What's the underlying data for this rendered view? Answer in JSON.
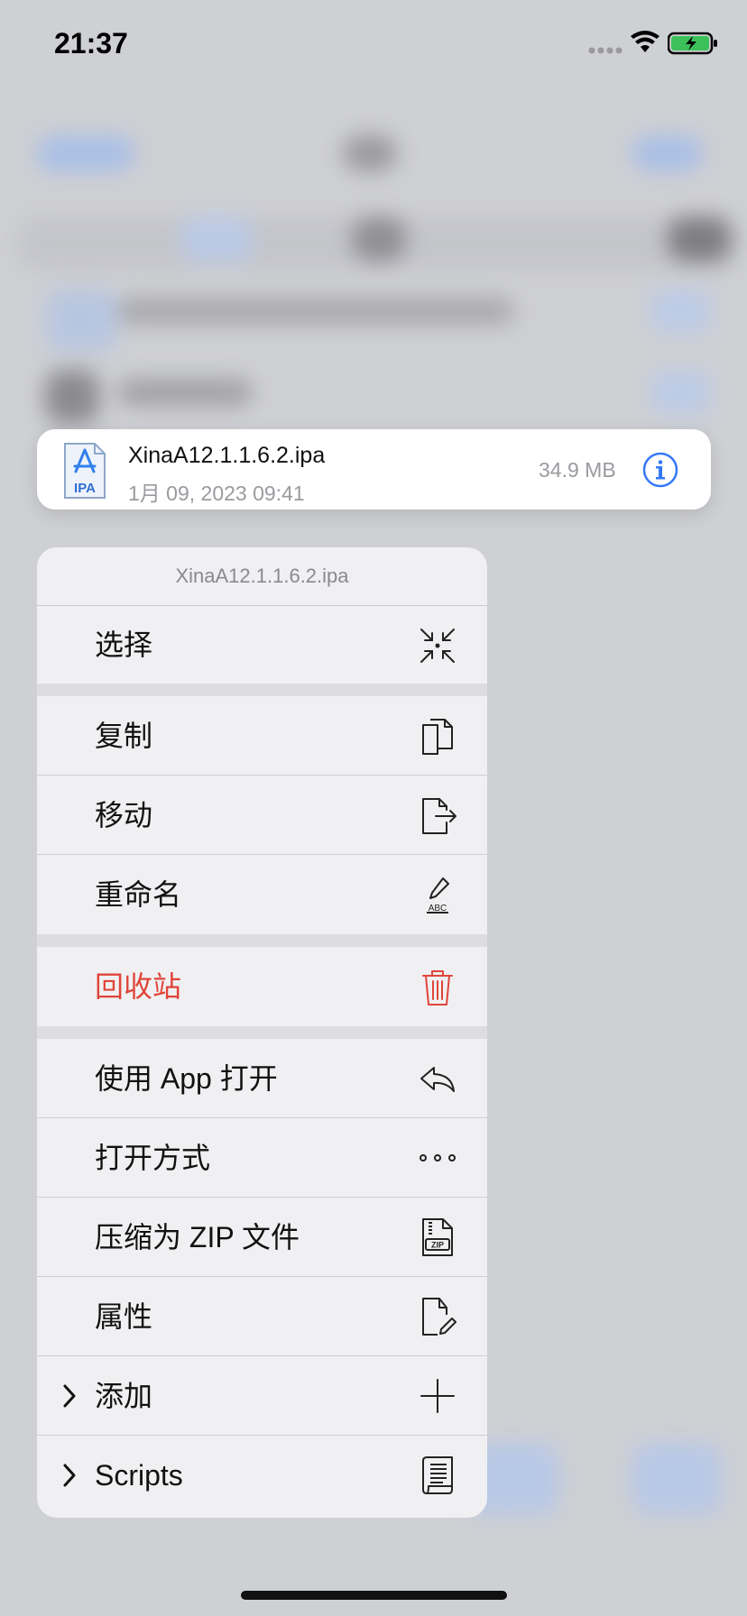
{
  "status_bar": {
    "time": "21:37"
  },
  "file": {
    "name": "XinaA12.1.1.6.2.ipa",
    "date": "1月 09, 2023 09:41",
    "size": "34.9 MB",
    "icon_label": "IPA"
  },
  "menu": {
    "header": "XinaA12.1.1.6.2.ipa",
    "select": "选择",
    "copy": "复制",
    "move": "移动",
    "rename": "重命名",
    "trash": "回收站",
    "open_with_app": "使用 App 打开",
    "open_method": "打开方式",
    "compress_zip": "压缩为 ZIP 文件",
    "properties": "属性",
    "add": "添加",
    "scripts": "Scripts"
  },
  "colors": {
    "accent": "#3478f6",
    "danger": "#e0453a"
  }
}
